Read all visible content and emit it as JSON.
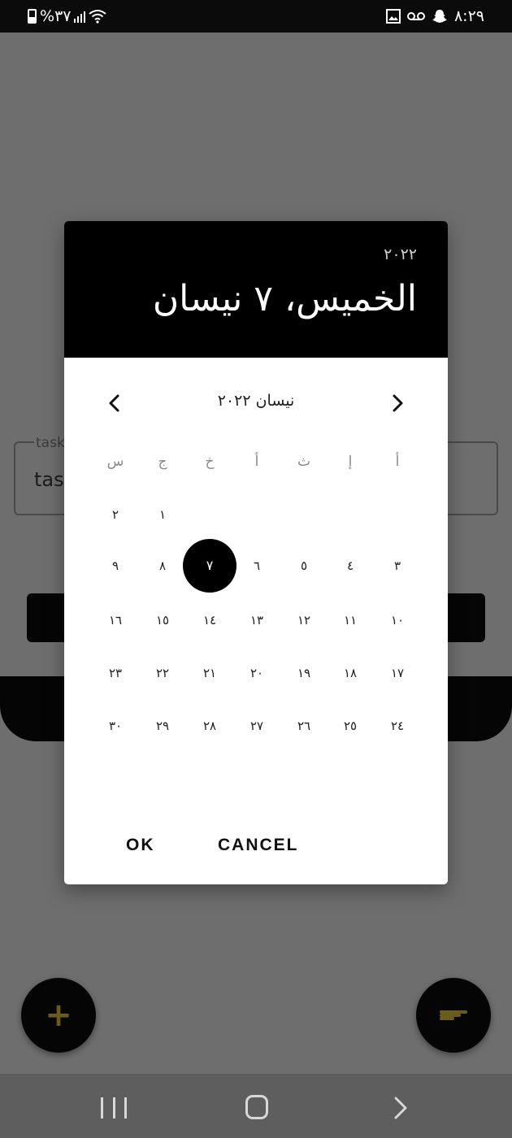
{
  "status_bar": {
    "time": "٨:٢٩",
    "battery": "%٣٧"
  },
  "background_app": {
    "field_label": "task",
    "field_value": "tas"
  },
  "fab_add": {
    "icon": "plus-icon",
    "glyph": "+"
  },
  "date_picker": {
    "year": "٢٠٢٢",
    "selected_date": "الخميس، ٧ نيسان",
    "month_title": "نيسان ٢٠٢٢",
    "weekdays": [
      "س",
      "ج",
      "خ",
      "أ",
      "ث",
      "إ",
      "أ"
    ],
    "weeks": [
      [
        "٢",
        "١",
        "",
        "",
        "",
        "",
        ""
      ],
      [
        "٩",
        "٨",
        "٧",
        "٦",
        "٥",
        "٤",
        "٣"
      ],
      [
        "١٦",
        "١٥",
        "١٤",
        "١٣",
        "١٢",
        "١١",
        "١٠"
      ],
      [
        "٢٣",
        "٢٢",
        "٢١",
        "٢٠",
        "١٩",
        "١٨",
        "١٧"
      ],
      [
        "٣٠",
        "٢٩",
        "٢٨",
        "٢٧",
        "٢٦",
        "٢٥",
        "٢٤"
      ]
    ],
    "selected_day": "٧",
    "ok_label": "OK",
    "cancel_label": "CANCEL"
  },
  "colors": {
    "accent": "#000000",
    "scrim": "#6e6e6e",
    "fab_icon": "#6b5c1b"
  }
}
